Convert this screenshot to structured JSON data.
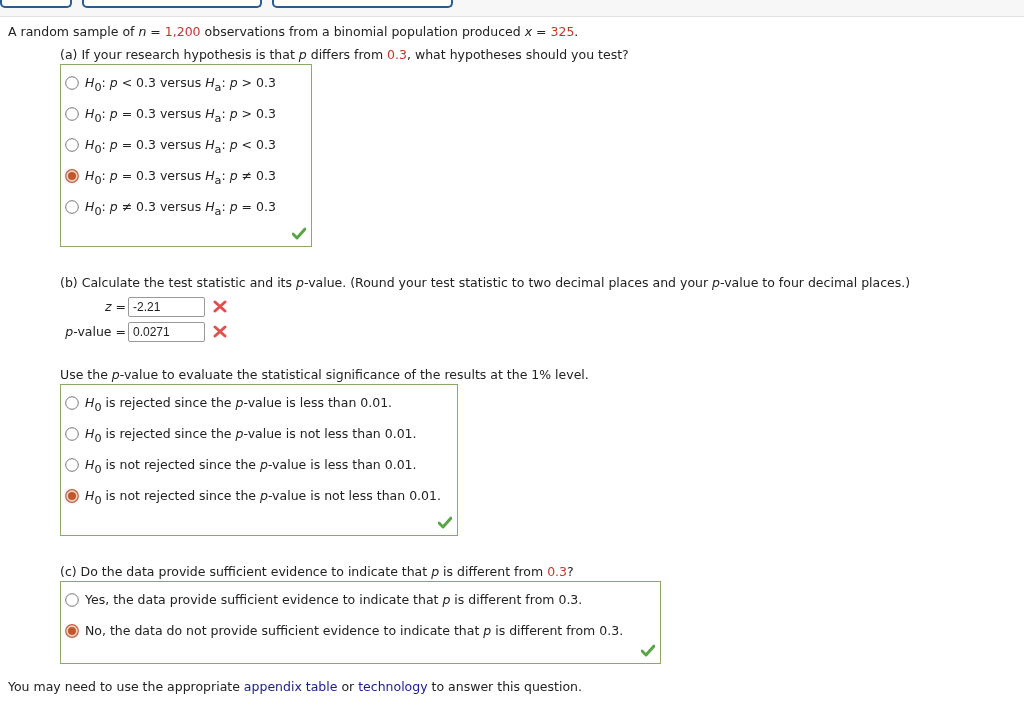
{
  "problem": [
    {
      "kind": "plain",
      "text": "A random sample of *n* = "
    },
    {
      "kind": "given",
      "text": "1,200"
    },
    {
      "kind": "plain",
      "text": " observations from a binomial population produced *x* = "
    },
    {
      "kind": "given",
      "text": "325"
    },
    {
      "kind": "plain",
      "text": "."
    }
  ],
  "part_a": {
    "question": [
      {
        "kind": "plain",
        "text": "(a) If your research hypothesis is that *p* differs from "
      },
      {
        "kind": "given",
        "text": "0.3"
      },
      {
        "kind": "plain",
        "text": ", what hypotheses should you test?"
      }
    ],
    "correct": true,
    "options": [
      {
        "label": "*H*$_{0}$: *p* < 0.3 versus *H*$_{a}$: *p* > 0.3",
        "selected": false
      },
      {
        "label": "*H*$_{0}$: *p* = 0.3 versus *H*$_{a}$: *p* > 0.3",
        "selected": false
      },
      {
        "label": "*H*$_{0}$: *p* = 0.3 versus *H*$_{a}$: *p* < 0.3",
        "selected": false
      },
      {
        "label": "*H*$_{0}$: *p* = 0.3 versus *H*$_{a}$: *p* ≠ 0.3",
        "selected": true
      },
      {
        "label": "*H*$_{0}$: *p* ≠ 0.3 versus *H*$_{a}$: *p* = 0.3",
        "selected": false
      }
    ]
  },
  "part_b": {
    "question": "(b) Calculate the test statistic and its *p*-value. (Round your test statistic to two decimal places and your *p*-value to four decimal places.)",
    "fields": [
      {
        "label": "*z* =",
        "value": "-2.21",
        "correct": false
      },
      {
        "label": "*p*-value =",
        "value": "0.0271",
        "correct": false
      }
    ],
    "significance_question": "Use the *p*-value to evaluate the statistical significance of the results at the 1% level.",
    "correct": true,
    "options": [
      {
        "label": "*H*$_{0}$ is rejected since the *p*-value is less than 0.01.",
        "selected": false
      },
      {
        "label": "*H*$_{0}$ is rejected since the *p*-value is not less than 0.01.",
        "selected": false
      },
      {
        "label": "*H*$_{0}$ is not rejected since the *p*-value is less than 0.01.",
        "selected": false
      },
      {
        "label": "*H*$_{0}$ is not rejected since the *p*-value is not less than 0.01.",
        "selected": true
      }
    ]
  },
  "part_c": {
    "question": [
      {
        "kind": "plain",
        "text": "(c) Do the data provide sufficient evidence to indicate that *p* is different from "
      },
      {
        "kind": "given",
        "text": "0.3"
      },
      {
        "kind": "plain",
        "text": "?"
      }
    ],
    "correct": true,
    "options": [
      {
        "label": "Yes, the data provide sufficient evidence to indicate that *p* is different from 0.3.",
        "selected": false
      },
      {
        "label": "No, the data do not provide sufficient evidence to indicate that *p* is different from 0.3.",
        "selected": true
      }
    ]
  },
  "footer": [
    {
      "kind": "plain",
      "text": "You may need to use the appropriate "
    },
    {
      "kind": "link",
      "text": "appendix table"
    },
    {
      "kind": "plain",
      "text": " or "
    },
    {
      "kind": "link",
      "text": "technology"
    },
    {
      "kind": "plain",
      "text": " to answer this question."
    }
  ]
}
